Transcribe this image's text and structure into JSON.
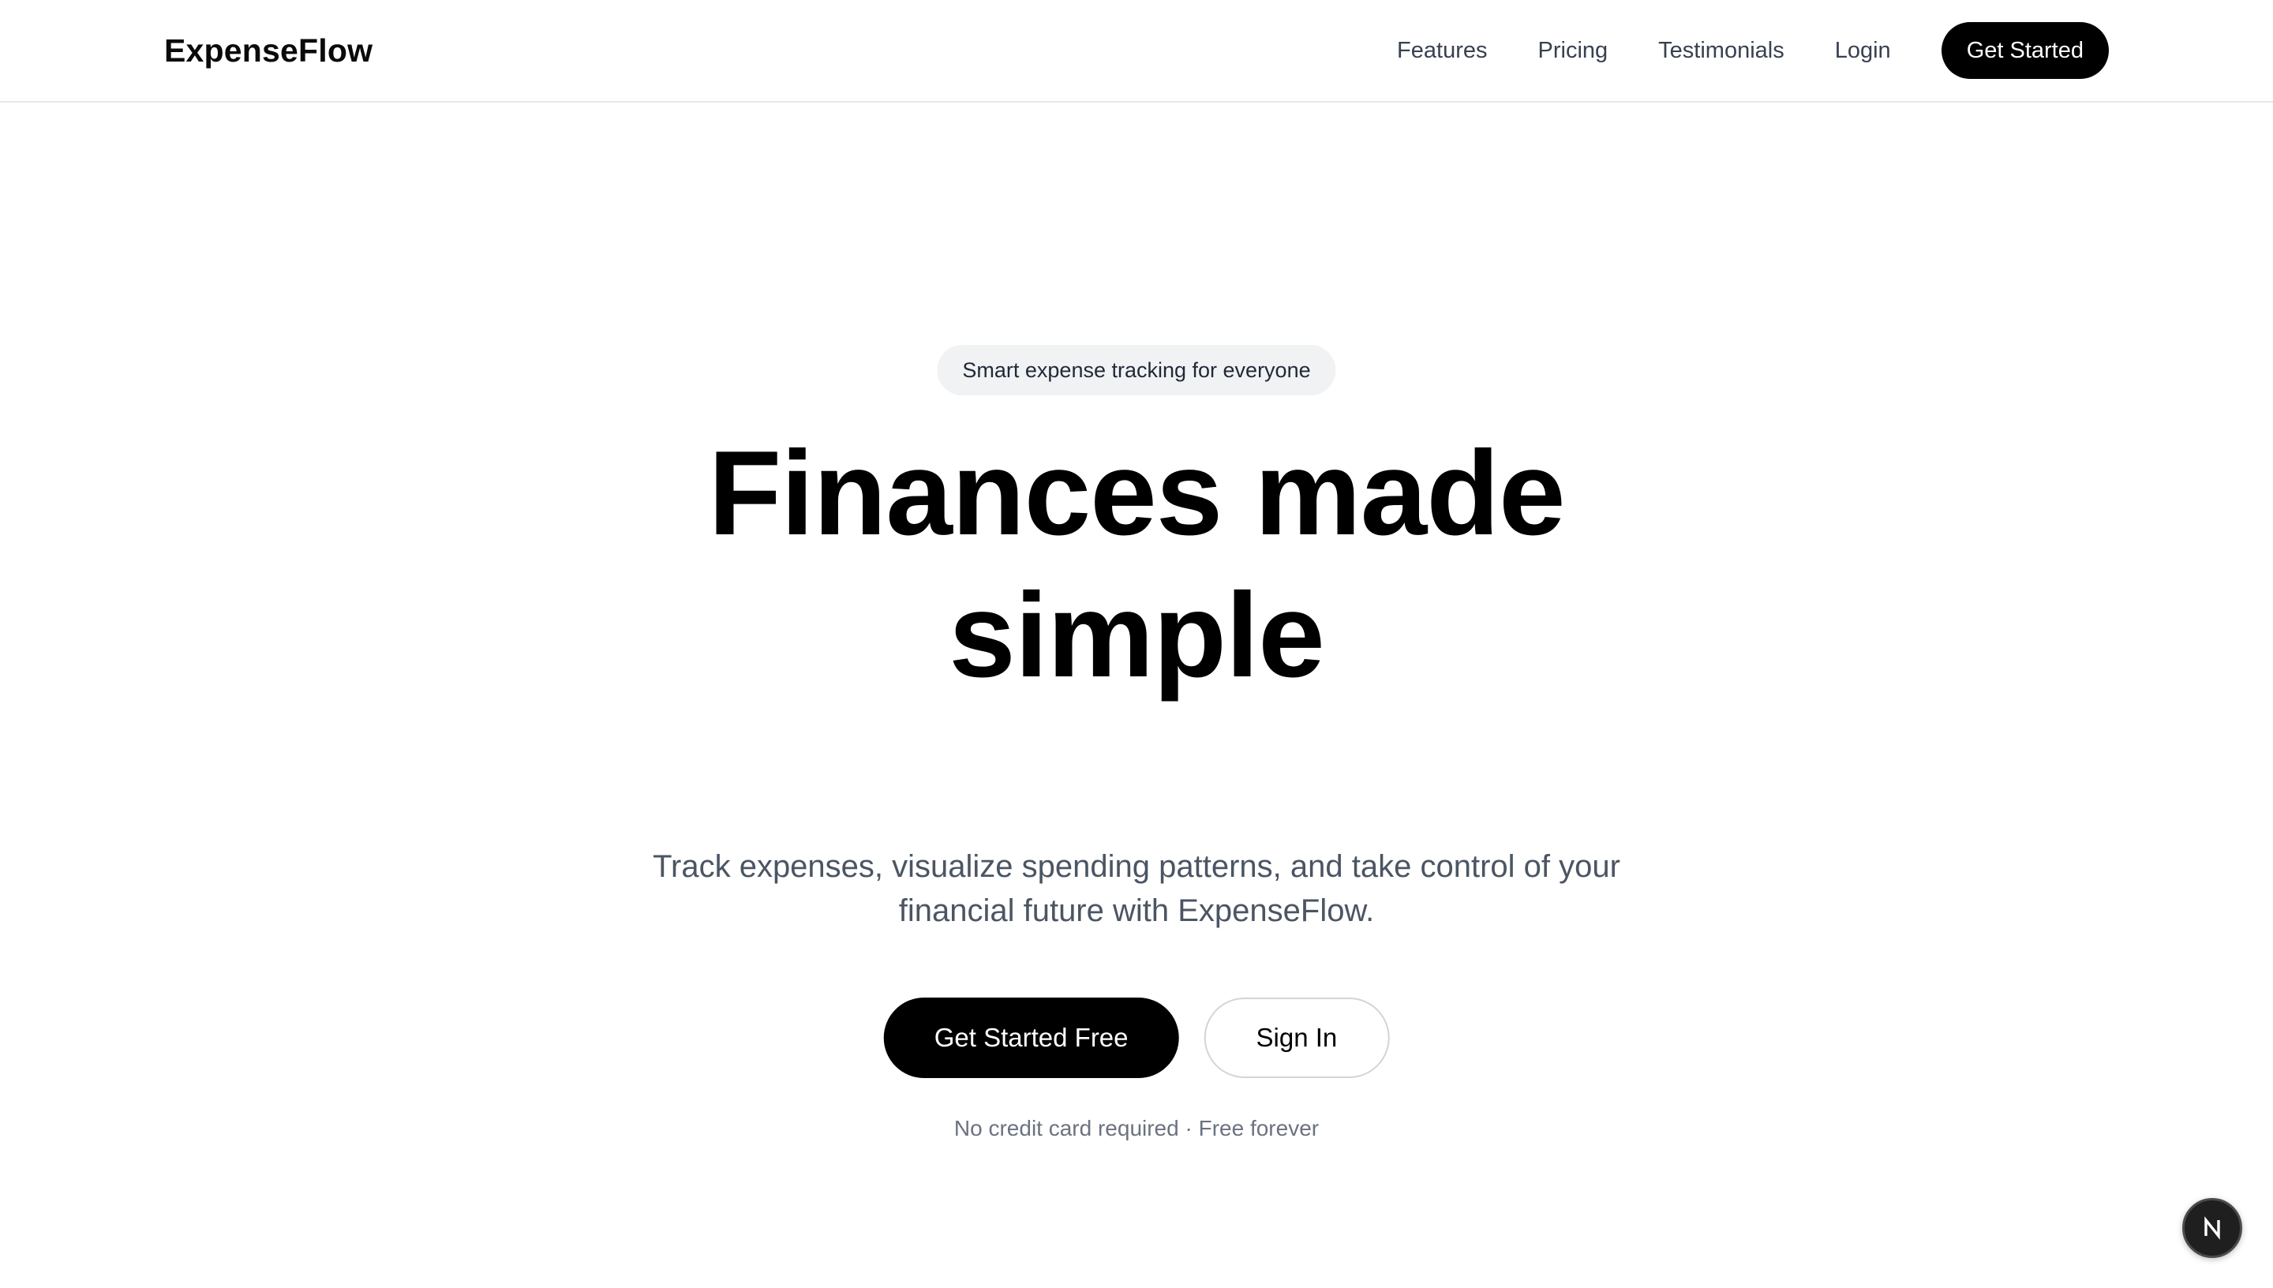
{
  "header": {
    "logo": "ExpenseFlow",
    "nav": [
      {
        "label": "Features"
      },
      {
        "label": "Pricing"
      },
      {
        "label": "Testimonials"
      },
      {
        "label": "Login"
      }
    ],
    "cta_label": "Get Started"
  },
  "hero": {
    "badge": "Smart expense tracking for everyone",
    "headline_line1": "Finances made",
    "headline_line2": "simple",
    "subheadline_line1": "Track expenses, visualize spending patterns, and take control of your",
    "subheadline_line2": "financial future with ExpenseFlow.",
    "primary_cta": "Get Started Free",
    "secondary_cta": "Sign In",
    "fineprint": "No credit card required · Free forever"
  },
  "dev_indicator": {
    "icon": "nextjs-logo-icon",
    "letter": "N"
  },
  "colors": {
    "primary": "#000000",
    "badge_bg": "#f1f2f4",
    "muted_text": "#6b7280",
    "nav_text": "#374151"
  }
}
